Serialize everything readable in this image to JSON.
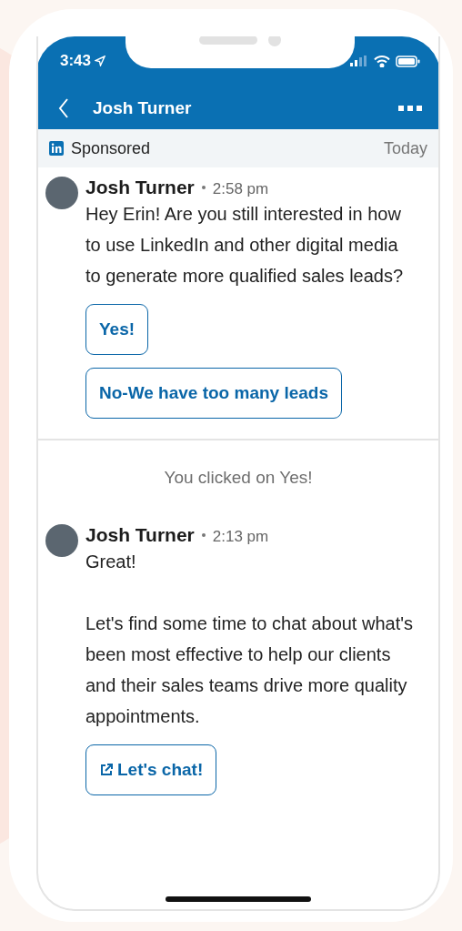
{
  "status_bar": {
    "time": "3:43"
  },
  "header": {
    "title": "Josh Turner"
  },
  "banner": {
    "label": "Sponsored",
    "date": "Today"
  },
  "feed": [
    {
      "kind": "message",
      "sender": "Josh Turner",
      "time": "2:58 pm",
      "paragraphs": [
        "Hey Erin! Are you still interested in how to use LinkedIn and other digital media to generate more qualified sales leads?"
      ],
      "buttons": [
        {
          "kind": "reply",
          "label": "Yes!"
        },
        {
          "kind": "reply",
          "label": "No-We have too many leads"
        }
      ]
    },
    {
      "kind": "note",
      "text": "You clicked on Yes!"
    },
    {
      "kind": "message",
      "sender": "Josh Turner",
      "time": "2:13 pm",
      "paragraphs": [
        "Great!",
        "Let's find some time to chat about what's been most effective to help our clients and their sales teams drive more quality appointments."
      ],
      "buttons": [
        {
          "kind": "link",
          "label": "Let's chat!"
        }
      ]
    }
  ]
}
